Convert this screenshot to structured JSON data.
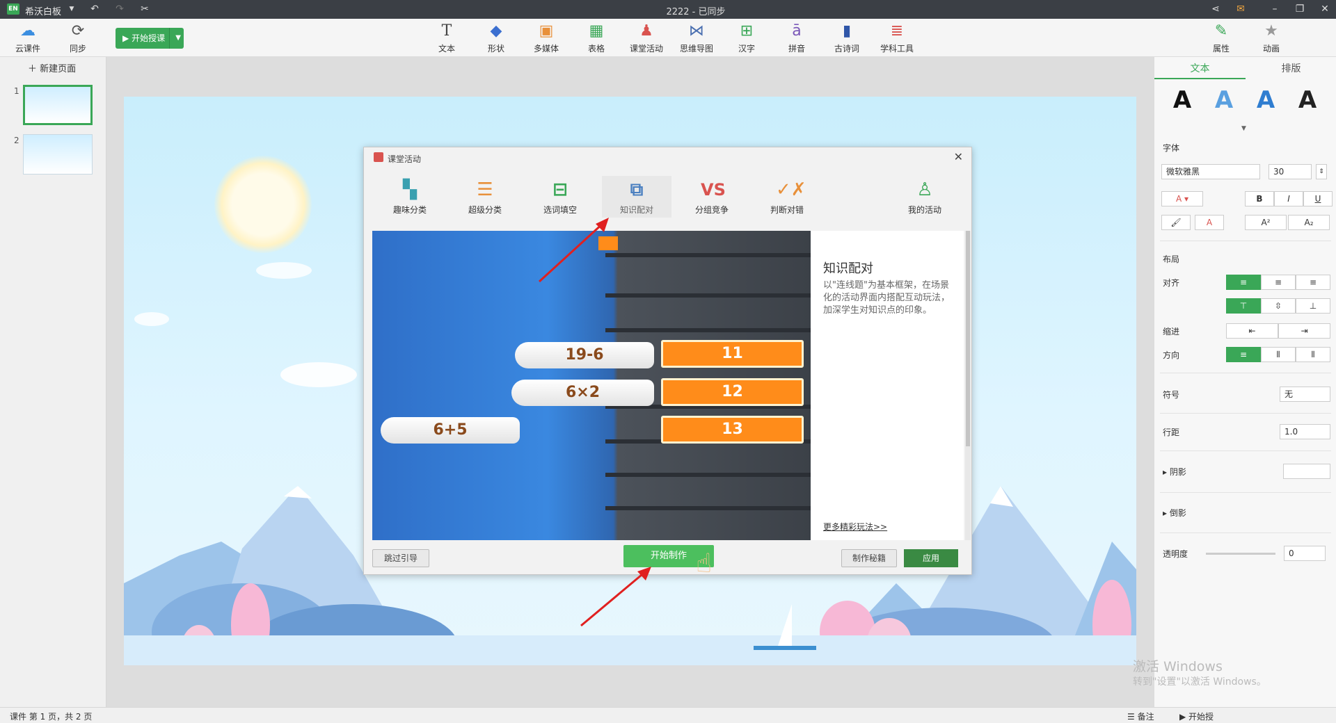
{
  "titlebar": {
    "logo": "EN",
    "app_name": "希沃白板",
    "doc_title": "2222 - 已同步"
  },
  "toolbar": {
    "cloud_label": "云课件",
    "sync_label": "同步",
    "start_label": "开始授课",
    "tools": [
      {
        "label": "文本"
      },
      {
        "label": "形状"
      },
      {
        "label": "多媒体"
      },
      {
        "label": "表格"
      },
      {
        "label": "课堂活动"
      },
      {
        "label": "思维导图"
      },
      {
        "label": "汉字"
      },
      {
        "label": "拼音"
      },
      {
        "label": "古诗词"
      },
      {
        "label": "学科工具"
      }
    ],
    "right_tools": [
      {
        "label": "属性"
      },
      {
        "label": "动画"
      }
    ]
  },
  "leftpanel": {
    "new_page": "新建页面",
    "pages": [
      {
        "num": "1"
      },
      {
        "num": "2"
      }
    ]
  },
  "dialog": {
    "title": "课堂活动",
    "activities": [
      {
        "label": "趣味分类"
      },
      {
        "label": "超级分类"
      },
      {
        "label": "选词填空"
      },
      {
        "label": "知识配对"
      },
      {
        "label": "分组竞争"
      },
      {
        "label": "判断对错"
      },
      {
        "label": "我的活动"
      }
    ],
    "selected_activity": "知识配对",
    "preview": {
      "questions": [
        "19-6",
        "6×2",
        "6+5"
      ],
      "answers": [
        "11",
        "12",
        "13"
      ]
    },
    "desc_title": "知识配对",
    "desc_text": "以\"连线题\"为基本框架，在场景化的活动界面内搭配互动玩法，加深学生对知识点的印象。",
    "more_link": "更多精彩玩法>>",
    "skip_label": "跳过引导",
    "make_label": "开始制作",
    "tips_label": "制作秘籍",
    "apply_label": "应用"
  },
  "rightpanel": {
    "tabs": [
      "文本",
      "排版"
    ],
    "font_section": "字体",
    "font_name": "微软雅黑",
    "font_size": "30",
    "layout_section": "布局",
    "align_label": "对齐",
    "indent_label": "缩进",
    "direction_label": "方向",
    "symbol_label": "符号",
    "symbol_value": "无",
    "line_spacing_label": "行距",
    "line_spacing_value": "1.0",
    "shadow_label": "阴影",
    "reflection_label": "倒影",
    "opacity_label": "透明度",
    "opacity_value": "0"
  },
  "statusbar": {
    "page_info": "课件 第 1 页，共 2 页",
    "notes_label": "备注",
    "start_label": "开始授"
  },
  "watermark": {
    "line1": "激活 Windows",
    "line2": "转到\"设置\"以激活 Windows。"
  },
  "colors": {
    "accent": "#3aa757",
    "titlebar": "#3b3f45"
  }
}
